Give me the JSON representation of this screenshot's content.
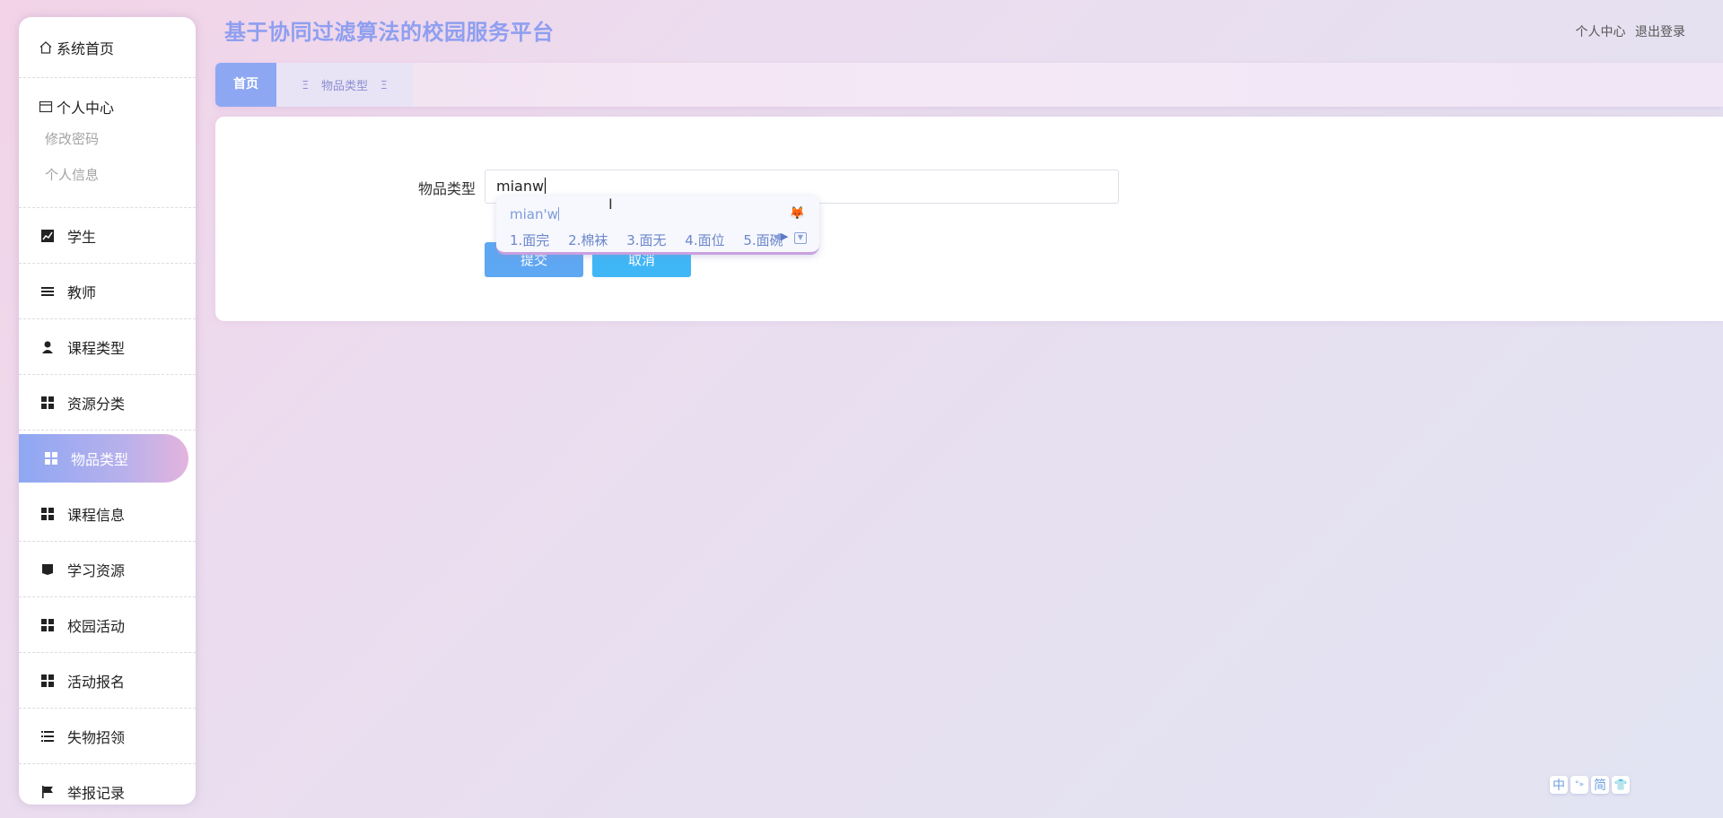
{
  "header": {
    "title": "基于协同过滤算法的校园服务平台",
    "links": [
      "个人中心",
      "退出登录"
    ]
  },
  "sidebar": {
    "home": "系统首页",
    "profile": {
      "title": "个人中心",
      "items": [
        "修改密码",
        "个人信息"
      ]
    },
    "items": [
      {
        "label": "学生",
        "icon": "chart-icon"
      },
      {
        "label": "教师",
        "icon": "list-icon"
      },
      {
        "label": "课程类型",
        "icon": "user-icon"
      },
      {
        "label": "资源分类",
        "icon": "grid-icon"
      },
      {
        "label": "物品类型",
        "icon": "grid-icon",
        "active": true
      },
      {
        "label": "课程信息",
        "icon": "grid-icon"
      },
      {
        "label": "学习资源",
        "icon": "box-icon"
      },
      {
        "label": "校园活动",
        "icon": "grid-icon"
      },
      {
        "label": "活动报名",
        "icon": "grid-icon"
      },
      {
        "label": "失物招领",
        "icon": "list-icon"
      },
      {
        "label": "举报记录",
        "icon": "flag-icon"
      }
    ]
  },
  "tabs": {
    "home": "首页",
    "current": "物品类型"
  },
  "form": {
    "label": "物品类型",
    "value": "mianw",
    "submit": "提交",
    "cancel": "取消"
  },
  "ime": {
    "composition": "mian'w",
    "candidates": [
      "1.面完",
      "2.棉袜",
      "3.面无",
      "4.面位",
      "5.面碗"
    ]
  },
  "ime_toolbar": [
    "中",
    "°»",
    "简",
    "👕"
  ]
}
